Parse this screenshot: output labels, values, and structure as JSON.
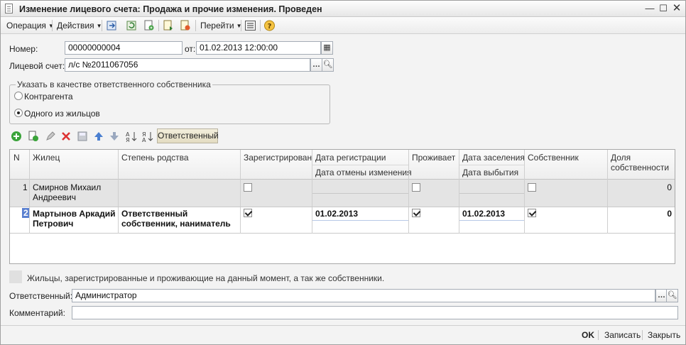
{
  "window": {
    "title": "Изменение лицевого счета: Продажа и прочие изменения. Проведен"
  },
  "toolbar": {
    "operation": "Операция",
    "actions": "Действия",
    "goto": "Перейти"
  },
  "form": {
    "number_label": "Номер:",
    "number_value": "00000000004",
    "date_label": "от:",
    "date_value": "01.02.2013 12:00:00",
    "account_label": "Лицевой счет:",
    "account_value": "л/с №2011067056",
    "group_title": "Указать в качестве ответственного собственника",
    "radio_contractor": "Контрагента",
    "radio_resident": "Одного из жильцов",
    "responsible_button": "Ответственный"
  },
  "table": {
    "columns": {
      "n": "N",
      "resident": "Жилец",
      "relation": "Степень родства",
      "registered": "Зарегистрирован",
      "reg_date": "Дата регистрации",
      "cancel_date": "Дата отмены изменения",
      "lives": "Проживает",
      "settle_date": "Дата заселения",
      "leave_date": "Дата выбытия",
      "owner": "Собственник",
      "share": "Доля собственности"
    },
    "rows": [
      {
        "n": "1",
        "resident": "Смирнов Михаил Андреевич",
        "relation": "",
        "registered": false,
        "reg_date": "",
        "lives": false,
        "settle_date": "",
        "owner": false,
        "share": "0"
      },
      {
        "n": "2",
        "resident": "Мартынов Аркадий Петрович",
        "relation": "Ответственный собственник, наниматель",
        "registered": true,
        "reg_date": "01.02.2013",
        "lives": true,
        "settle_date": "01.02.2013",
        "owner": true,
        "share": "0"
      }
    ]
  },
  "legend": {
    "text": "Жильцы, зарегистрированные и проживающие на данный момент, а так же собственники."
  },
  "responsible": {
    "label": "Ответственный:",
    "value": "Администратор"
  },
  "comment": {
    "label": "Комментарий:",
    "value": ""
  },
  "buttons": {
    "ok": "OK",
    "save": "Записать",
    "close": "Закрыть"
  }
}
